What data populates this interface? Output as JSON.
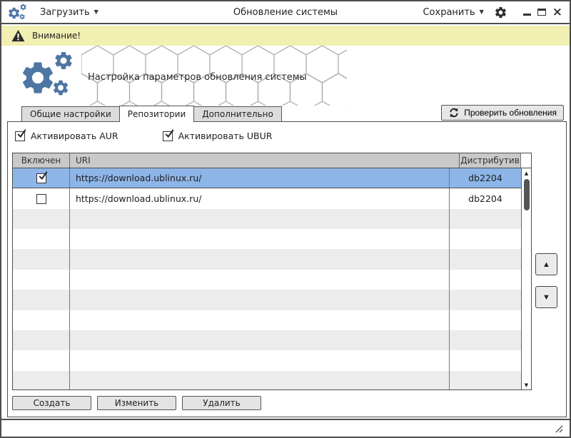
{
  "titlebar": {
    "load_label": "Загрузить",
    "title": "Обновление системы",
    "save_label": "Сохранить"
  },
  "warning": {
    "text": "Внимание!"
  },
  "hero": {
    "heading": "Настройка параметров обновления системы"
  },
  "tabs": [
    {
      "label": "Общие настройки",
      "active": false
    },
    {
      "label": "Репозитории",
      "active": true
    },
    {
      "label": "Дополнительно",
      "active": false
    }
  ],
  "toolbar": {
    "check_updates_label": "Проверить обновления"
  },
  "checkboxes": [
    {
      "label": "Активировать AUR",
      "checked": true
    },
    {
      "label": "Активировать UBUR",
      "checked": true
    }
  ],
  "table": {
    "columns": {
      "enabled": "Включен",
      "uri": "URI",
      "distro": "Дистрибутив"
    },
    "rows": [
      {
        "enabled": true,
        "uri": "https://download.ublinux.ru/",
        "distro": "db2204",
        "selected": true
      },
      {
        "enabled": false,
        "uri": "https://download.ublinux.ru/",
        "distro": "db2204",
        "selected": false
      }
    ],
    "empty_row_count": 9
  },
  "actions": {
    "create": "Создать",
    "edit": "Изменить",
    "delete": "Удалить"
  },
  "colors": {
    "accent_blue": "#4d76a4",
    "selection_blue": "#8db5e8",
    "warning_bg": "#f1efb2",
    "header_gray": "#c9c9c9",
    "alt_row_gray": "#ececec"
  }
}
